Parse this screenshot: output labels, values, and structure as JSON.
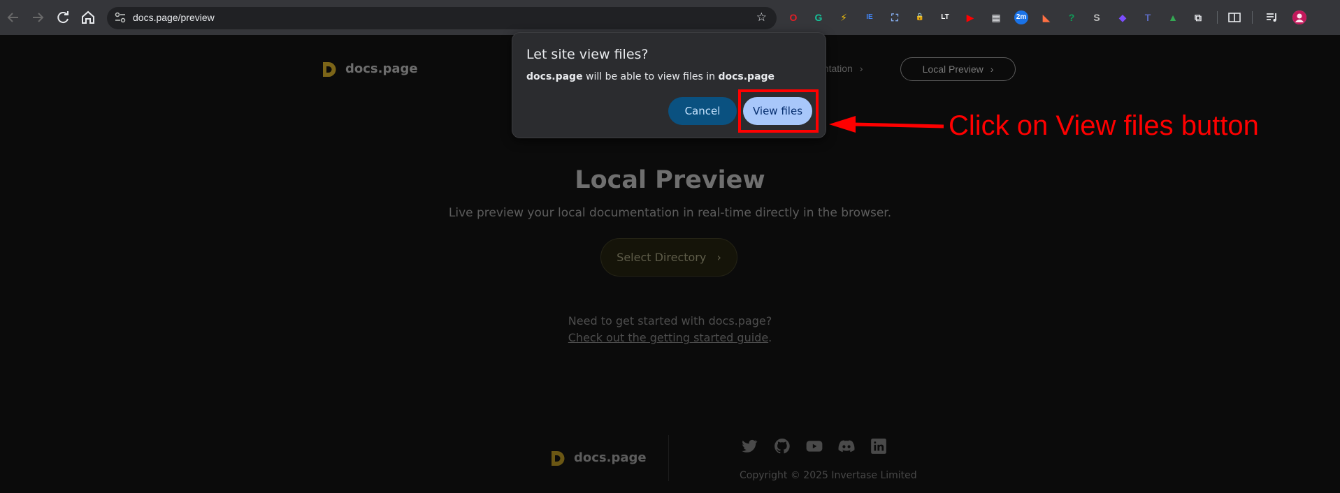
{
  "browser": {
    "url": "docs.page/preview",
    "back_icon": "arrow-left-icon",
    "forward_icon": "arrow-right-icon",
    "reload_icon": "reload-icon",
    "home_icon": "home-icon",
    "extensions": [
      {
        "name": "opera-icon",
        "color": "#e41e26",
        "glyph": "O"
      },
      {
        "name": "grammarly-icon",
        "color": "#15c39a",
        "glyph": "G"
      },
      {
        "name": "bolt-icon",
        "color": "#f4c20d",
        "glyph": "⚡"
      },
      {
        "name": "translate-icon",
        "color": "#4285f4",
        "glyph": "IE"
      },
      {
        "name": "screenshot-icon",
        "color": "#8ab4f8",
        "glyph": "⛶"
      },
      {
        "name": "lock-icon",
        "color": "#9aa0a6",
        "glyph": "🔒"
      },
      {
        "name": "languagetool-icon",
        "color": "#ffffff",
        "glyph": "LT"
      },
      {
        "name": "youtube-icon",
        "color": "#ff0000",
        "glyph": "▶"
      },
      {
        "name": "calendar-icon",
        "color": "#e8eaed",
        "glyph": "▦"
      },
      {
        "name": "timer-icon",
        "color": "#1a73e8",
        "glyph": "2m",
        "badge": "2m"
      },
      {
        "name": "ext-orange-icon",
        "color": "#ff7043",
        "glyph": "◣"
      },
      {
        "name": "help-icon",
        "color": "#0f9d58",
        "glyph": "?"
      },
      {
        "name": "ext-s-icon",
        "color": "#bdbdbd",
        "glyph": "S"
      },
      {
        "name": "drop-icon",
        "color": "#7c4dff",
        "glyph": "◆"
      },
      {
        "name": "ext-t-icon",
        "color": "#5c6bc0",
        "glyph": "T"
      },
      {
        "name": "tree-icon",
        "color": "#34a853",
        "glyph": "▲"
      },
      {
        "name": "extensions-puzzle-icon",
        "color": "#e8eaed",
        "glyph": "⧉"
      }
    ],
    "reader_icon": "reading-mode-icon",
    "media_icon": "media-control-icon",
    "profile_icon": "profile-avatar-icon"
  },
  "site": {
    "logo_text": "docs.page",
    "nav_partial": "entation",
    "local_preview_label": "Local Preview",
    "hero_title": "Local Preview",
    "hero_subtitle": "Live preview your local documentation in real-time directly in the browser.",
    "select_directory_label": "Select Directory",
    "need_text": "Need to get started with docs.page?",
    "guide_link": "Check out the getting started guide",
    "guide_suffix": ".",
    "footer_logo_text": "docs.page",
    "copyright": "Copyright © 2025 Invertase Limited",
    "social_icons": [
      "twitter-icon",
      "github-icon",
      "youtube-icon",
      "discord-icon",
      "linkedin-icon"
    ]
  },
  "dialog": {
    "title": "Let site view files?",
    "site": "docs.page",
    "message_middle": " will be able to view files in ",
    "site2": "docs.page",
    "cancel_label": "Cancel",
    "view_label": "View files"
  },
  "annotation": {
    "text": "Click on View files button",
    "color": "#ff0000"
  }
}
